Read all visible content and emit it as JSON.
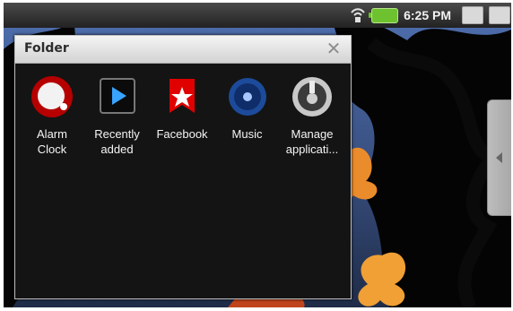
{
  "status_bar": {
    "time": "6:25 PM"
  },
  "folder": {
    "title": "Folder"
  },
  "apps": [
    {
      "label": "Alarm\nClock",
      "icon": "alarm-clock-icon"
    },
    {
      "label": "Recently\nadded",
      "icon": "recently-added-icon"
    },
    {
      "label": "Facebook",
      "icon": "facebook-icon"
    },
    {
      "label": "Music",
      "icon": "music-icon"
    },
    {
      "label": "Manage\napplicati...",
      "icon": "manage-applications-icon"
    }
  ]
}
